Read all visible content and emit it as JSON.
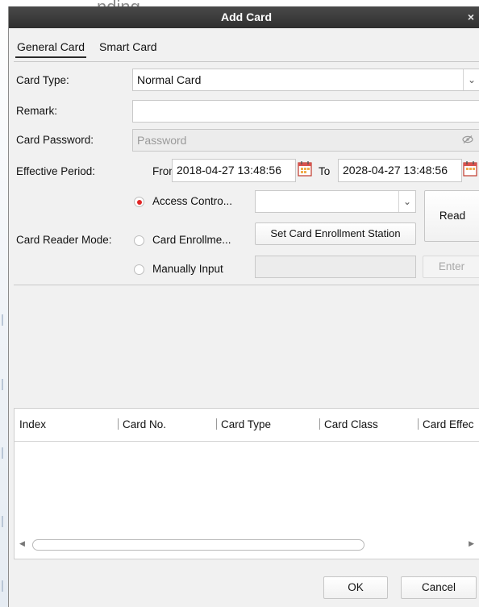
{
  "background": {
    "partial_text": "nding"
  },
  "dialog": {
    "title": "Add Card",
    "close_glyph": "×"
  },
  "tabs": [
    {
      "label": "General Card",
      "active": true
    },
    {
      "label": "Smart Card",
      "active": false
    }
  ],
  "form": {
    "card_type": {
      "label": "Card Type:",
      "value": "Normal Card"
    },
    "remark": {
      "label": "Remark:",
      "value": ""
    },
    "card_password": {
      "label": "Card Password:",
      "placeholder": "Password"
    },
    "effective_period": {
      "label": "Effective Period:",
      "from_label": "From",
      "from_value": "2018-04-27 13:48:56",
      "to_label": "To",
      "to_value": "2028-04-27 13:48:56"
    },
    "card_reader_mode": {
      "label": "Card Reader Mode:",
      "options": [
        {
          "label": "Access Contro...",
          "checked": true
        },
        {
          "label": "Card Enrollme...",
          "checked": false
        },
        {
          "label": "Manually Input",
          "checked": false
        }
      ],
      "access_controller_value": "",
      "set_enrollment_button": "Set Card Enrollment Station",
      "read_button": "Read",
      "manual_input_value": "",
      "enter_button": "Enter"
    }
  },
  "table": {
    "columns": [
      "Index",
      "Card No.",
      "Card Type",
      "Card Class",
      "Card Effec"
    ],
    "rows": []
  },
  "footer": {
    "ok_button": "OK",
    "cancel_button": "Cancel"
  },
  "colors": {
    "titlebar": "#3a3a3a",
    "radio_checked": "#e02525",
    "dialog_bg": "#f1f1f1"
  }
}
